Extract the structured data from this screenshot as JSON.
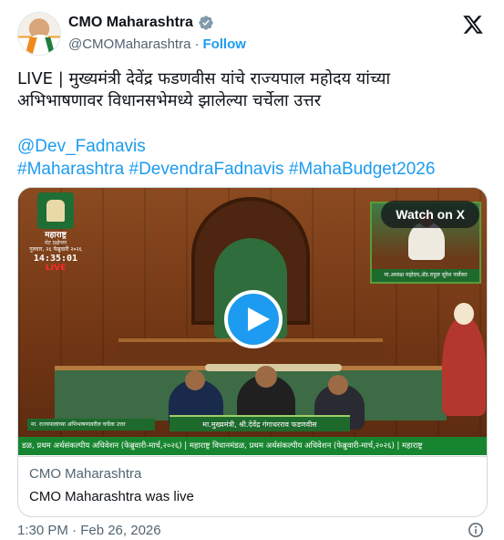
{
  "header": {
    "display_name": "CMO Maharashtra",
    "handle": "@CMOMaharashtra",
    "separator": "·",
    "follow_label": "Follow",
    "verified_icon": "verified-badge-icon",
    "platform_icon": "x-logo-icon"
  },
  "tweet": {
    "text_line1": "LIVE | मुख्यमंत्री देवेंद्र फडणवीस यांचे राज्यपाल महोदय यांच्या",
    "text_line2": "अभिभाषणावर विधानसभेमध्ये झालेल्या चर्चेला उत्तर",
    "mention": "@Dev_Fadnavis",
    "hashtags": [
      "#Maharashtra",
      "#DevendraFadnavis",
      "#MahaBudget2026"
    ]
  },
  "media": {
    "watch_label": "Watch on X",
    "play_icon": "play-icon",
    "overlay": {
      "logo_title": "महाराष्ट्र",
      "logo_subtitle": "थेट प्रक्षेपण",
      "date": "गुरुवार, २६ फेब्रुवारी २०२६",
      "time": "14:35:01",
      "live": "LIVE",
      "pip_caption": "मा.अध्यक्ष महोदय,ॲड.राहुल सुरेश नार्वेकर",
      "caption_left": "मा. राज्यपालांच्या अभिभाषणावरील चर्चेला उत्तर",
      "caption_center": "मा.मुख्यमंत्री, श्री.देवेंद्र गंगाधरराव फडणवीस",
      "ticker": "डळ, प्रथम अर्थसंकल्पीय अधिवेशन (फेब्रुवारी-मार्च,२०२६) | महाराष्ट्र विधानमंडळ, प्रथम अर्थसंकल्पीय अधिवेशन (फेब्रुवारी-मार्च,२०२६) | महाराष्ट्र"
    },
    "card_source": "CMO Maharashtra",
    "card_description": "CMO Maharashtra was live"
  },
  "footer": {
    "timestamp": "1:30 PM · Feb 26, 2026",
    "info_icon": "info-icon"
  },
  "colors": {
    "link": "#1d9bf0",
    "text": "#0f1419",
    "muted": "#536471",
    "border": "#cfd9de"
  }
}
